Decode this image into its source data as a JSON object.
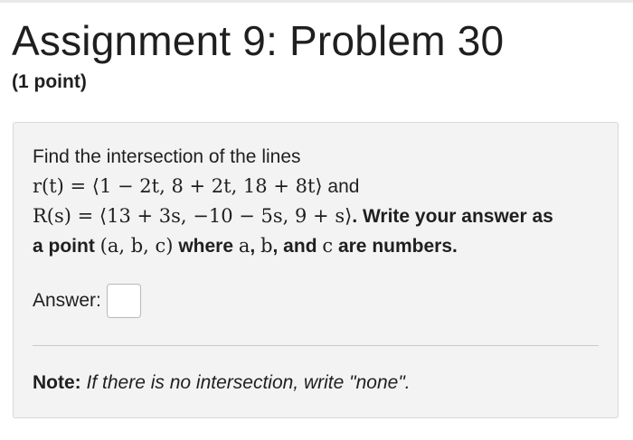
{
  "header": {
    "title": "Assignment 9: Problem 30",
    "points": "(1 point)"
  },
  "problem": {
    "intro": "Find the intersection of the lines",
    "line1_math": "r(t) = ⟨1 − 2t, 8 + 2t, 18 + 8t⟩",
    "line1_suffix": " and",
    "line2_math": "R(s) = ⟨13 + 3s, −10 − 5s, 9 + s⟩",
    "line2_suffix": ". Write your answer as",
    "line3_prefix": "a point ",
    "point_math": "(a, b, c)",
    "line3_mid1": " where ",
    "var_a": "a",
    "comma1": ", ",
    "var_b": "b",
    "comma2": ", and ",
    "var_c": "c",
    "line3_suffix": " are numbers."
  },
  "answer": {
    "label": "Answer:",
    "value": ""
  },
  "note": {
    "label": "Note:",
    "text": "If there is no intersection, write \"none\"."
  }
}
